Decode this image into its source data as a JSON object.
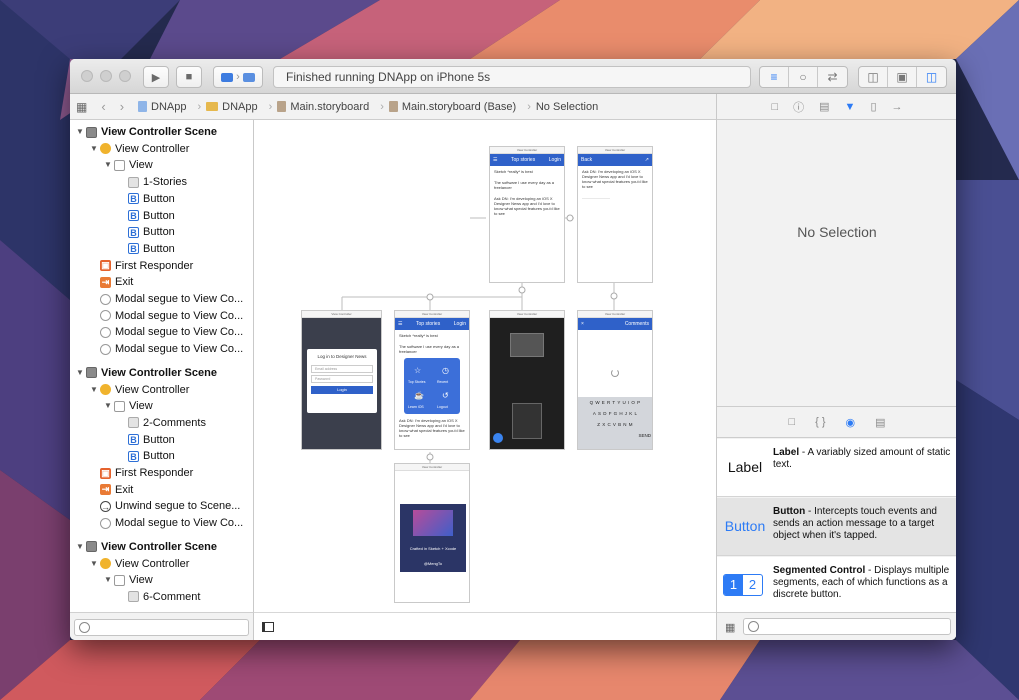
{
  "window": {
    "status_text": "Finished running DNApp on iPhone 5s"
  },
  "jumpbar": {
    "items": [
      "DNApp",
      "DNApp",
      "Main.storyboard",
      "Main.storyboard (Base)",
      "No Selection"
    ]
  },
  "outline": {
    "rows": [
      {
        "label": "View Controller Scene",
        "icon": "scene-icon",
        "level": 0,
        "bold": true
      },
      {
        "label": "View Controller",
        "icon": "view-controller-icon",
        "level": 1
      },
      {
        "label": "View",
        "icon": "view-icon",
        "level": 2
      },
      {
        "label": "1-Stories",
        "icon": "image-view-icon",
        "level": 3
      },
      {
        "label": "Button",
        "icon": "button-icon",
        "level": 3
      },
      {
        "label": "Button",
        "icon": "button-icon",
        "level": 3
      },
      {
        "label": "Button",
        "icon": "button-icon",
        "level": 3
      },
      {
        "label": "Button",
        "icon": "button-icon",
        "level": 3
      },
      {
        "label": "First Responder",
        "icon": "first-responder-icon",
        "level": 1
      },
      {
        "label": "Exit",
        "icon": "exit-icon",
        "level": 1
      },
      {
        "label": "Modal segue to View Co...",
        "icon": "segue-icon",
        "level": 1
      },
      {
        "label": "Modal segue to View Co...",
        "icon": "segue-icon",
        "level": 1
      },
      {
        "label": "Modal segue to View Co...",
        "icon": "segue-icon",
        "level": 1
      },
      {
        "label": "Modal segue to View Co...",
        "icon": "segue-icon",
        "level": 1
      },
      {
        "label": "View Controller Scene",
        "icon": "scene-icon",
        "level": 0,
        "bold": true
      },
      {
        "label": "View Controller",
        "icon": "view-controller-icon",
        "level": 1
      },
      {
        "label": "View",
        "icon": "view-icon",
        "level": 2
      },
      {
        "label": "2-Comments",
        "icon": "image-view-icon",
        "level": 3
      },
      {
        "label": "Button",
        "icon": "button-icon",
        "level": 3
      },
      {
        "label": "Button",
        "icon": "button-icon",
        "level": 3
      },
      {
        "label": "First Responder",
        "icon": "first-responder-icon",
        "level": 1
      },
      {
        "label": "Exit",
        "icon": "exit-icon",
        "level": 1
      },
      {
        "label": "Unwind segue to Scene...",
        "icon": "unwind-segue-icon",
        "level": 1
      },
      {
        "label": "Modal segue to View Co...",
        "icon": "segue-icon",
        "level": 1
      },
      {
        "label": "View Controller Scene",
        "icon": "scene-icon",
        "level": 0,
        "bold": true
      },
      {
        "label": "View Controller",
        "icon": "view-controller-icon",
        "level": 1
      },
      {
        "label": "View",
        "icon": "view-icon",
        "level": 2
      },
      {
        "label": "6-Comment",
        "icon": "image-view-icon",
        "level": 3
      }
    ]
  },
  "canvas": {
    "vc_title": "View Controller",
    "top_stories": "Top stories",
    "login": "Login",
    "back": "Back",
    "comments": "Comments",
    "story_1": "Sketch *really* is best",
    "story_2": "The software I use every day as a freelancer",
    "story_3": "Ask DN: I'm developing an iOS X Designer News app and I'd love to know what special features you'd like to see",
    "login_heading": "Log in to Designer News",
    "email_placeholder": "Email address",
    "password_placeholder": "Password",
    "login_button": "Login",
    "menu_items": [
      "Top Stories",
      "Recent",
      "Learn iOS",
      "Logout"
    ],
    "crafted": "Crafted in Sketch + Xcode",
    "handle": "@MengTo",
    "kb_row1": "QWERTYUIOP",
    "kb_row2": "ASDFGHJKL",
    "kb_row3": "ZXCVBNM",
    "send": "SEND"
  },
  "inspector": {
    "no_selection": "No Selection"
  },
  "library": [
    {
      "icon_text": "Label",
      "title": "Label",
      "desc": " - A variably sized amount of static text."
    },
    {
      "icon_text": "Button",
      "title": "Button",
      "desc": " - Intercepts touch events and sends an action message to a target object when it's tapped."
    },
    {
      "icon_text": "",
      "title": "Segmented Control",
      "desc": " - Displays multiple segments, each of which functions as a discrete button."
    }
  ],
  "segmented_icon": [
    "1",
    "2"
  ],
  "colors": {
    "accent": "#2d7bf5",
    "nav_blue": "#2f61c9",
    "toolbar": "#dcdcdc"
  }
}
